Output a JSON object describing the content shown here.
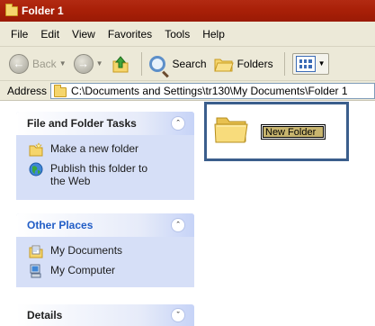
{
  "window": {
    "title": "Folder 1",
    "title_bar_color": "#a92008"
  },
  "menu": {
    "items": [
      "File",
      "Edit",
      "View",
      "Favorites",
      "Tools",
      "Help"
    ]
  },
  "toolbar": {
    "back_label": "Back",
    "search_label": "Search",
    "folders_label": "Folders"
  },
  "address": {
    "label": "Address",
    "path": "C:\\Documents and Settings\\tr130\\My Documents\\Folder 1"
  },
  "panels": {
    "file_tasks": {
      "title": "File and Folder Tasks",
      "items": [
        {
          "label": "Make a new folder",
          "icon": "new-folder-icon"
        },
        {
          "label": "Publish this folder to the Web",
          "icon": "globe-icon"
        }
      ]
    },
    "other_places": {
      "title": "Other Places",
      "items": [
        {
          "label": "My Documents",
          "icon": "my-documents-icon"
        },
        {
          "label": "My Computer",
          "icon": "my-computer-icon"
        }
      ]
    },
    "details": {
      "title": "Details"
    }
  },
  "content": {
    "new_folder_name": "New Folder"
  },
  "colors": {
    "task_pane_bg": "#d6dff7",
    "panel_title_blue": "#215dc6",
    "selection_outline": "#3b5e8c",
    "rename_highlight": "#c8b56f"
  }
}
